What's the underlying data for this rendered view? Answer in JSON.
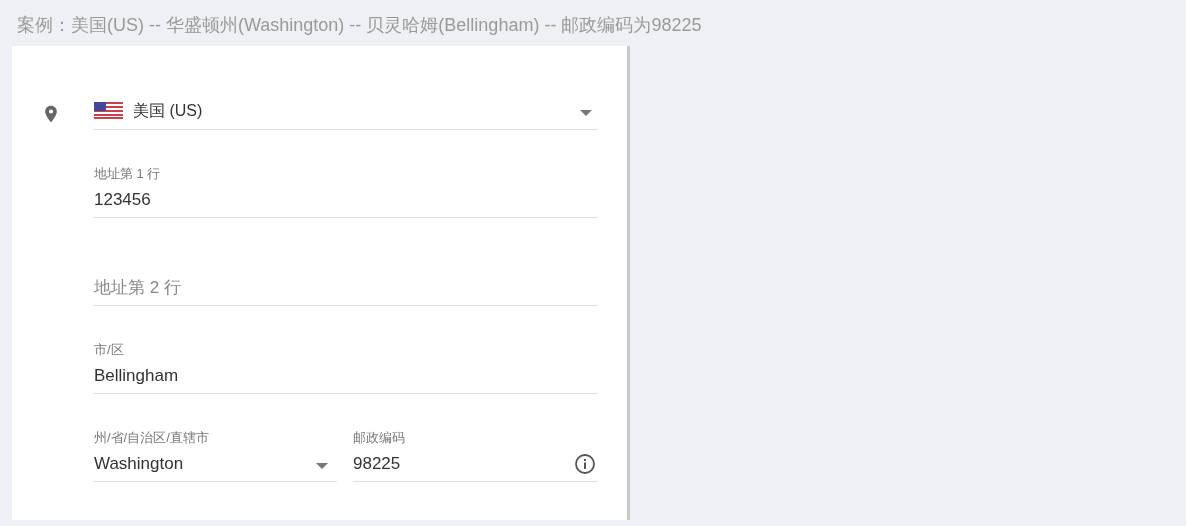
{
  "caption": "案例：美国(US) -- 华盛顿州(Washington) -- 贝灵哈姆(Bellingham) -- 邮政编码为98225",
  "country": {
    "value": "美国 (US)",
    "kind": "dropdown"
  },
  "fields": [
    {
      "label": "地址第 1 行",
      "value": "123456"
    },
    {
      "placeholder": "地址第 2 行"
    },
    {
      "label": "市/区",
      "value": "Bellingham"
    }
  ],
  "split_fields": [
    {
      "kind": "dropdown",
      "label": "州/省/自治区/直辖市",
      "value": "Washington"
    },
    {
      "kind": "info",
      "label": "邮政编码",
      "value": "98225"
    }
  ]
}
